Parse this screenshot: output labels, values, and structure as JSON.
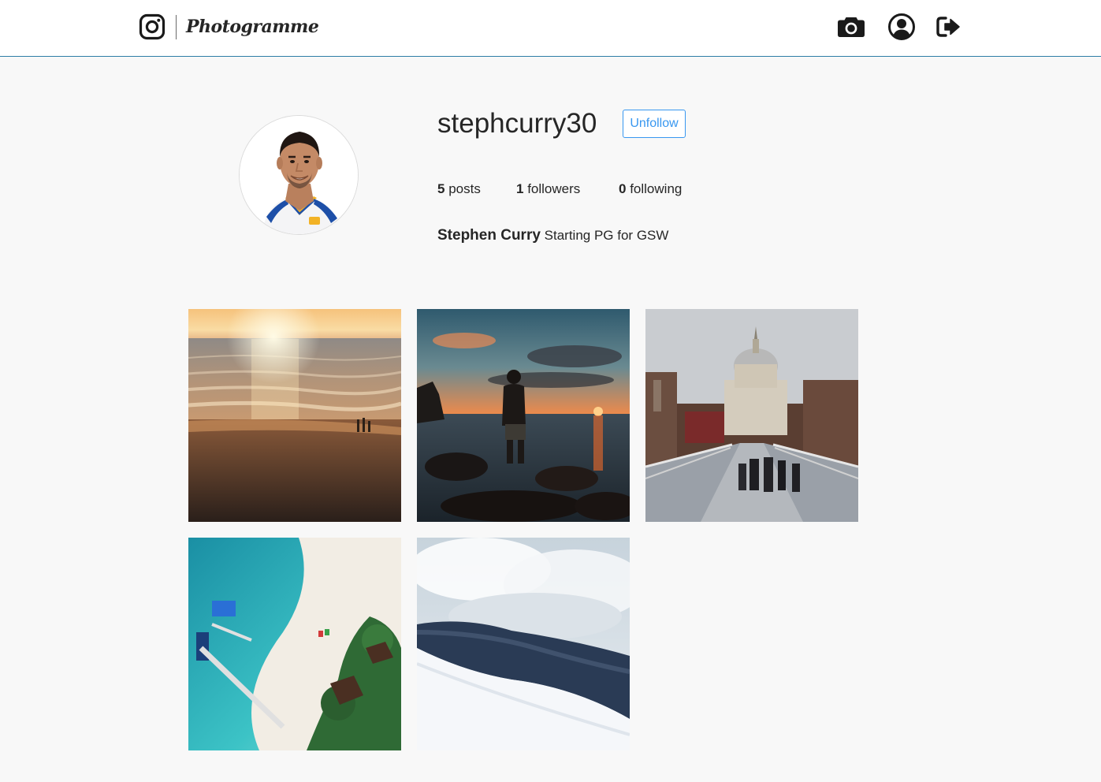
{
  "app": {
    "name": "Photogramme"
  },
  "header": {
    "icons": [
      "instagram-logo-icon",
      "camera-icon",
      "user-circle-icon",
      "sign-out-icon"
    ]
  },
  "profile": {
    "username": "stephcurry30",
    "follow_button_label": "Unfollow",
    "stats": {
      "posts_count": "5",
      "posts_label": "posts",
      "followers_count": "1",
      "followers_label": "followers",
      "following_count": "0",
      "following_label": "following"
    },
    "full_name": "Stephen Curry",
    "bio": "Starting PG for GSW"
  },
  "posts": [
    {
      "subject": "beach sunset"
    },
    {
      "subject": "man on rocks at sunset"
    },
    {
      "subject": "st pauls cathedral bridge"
    },
    {
      "subject": "aerial tropical beach"
    },
    {
      "subject": "snowy mountain forest"
    }
  ],
  "colors": {
    "accent": "#3897f0",
    "header_border": "#2f7ea6",
    "page_background": "#f8f8f8"
  }
}
